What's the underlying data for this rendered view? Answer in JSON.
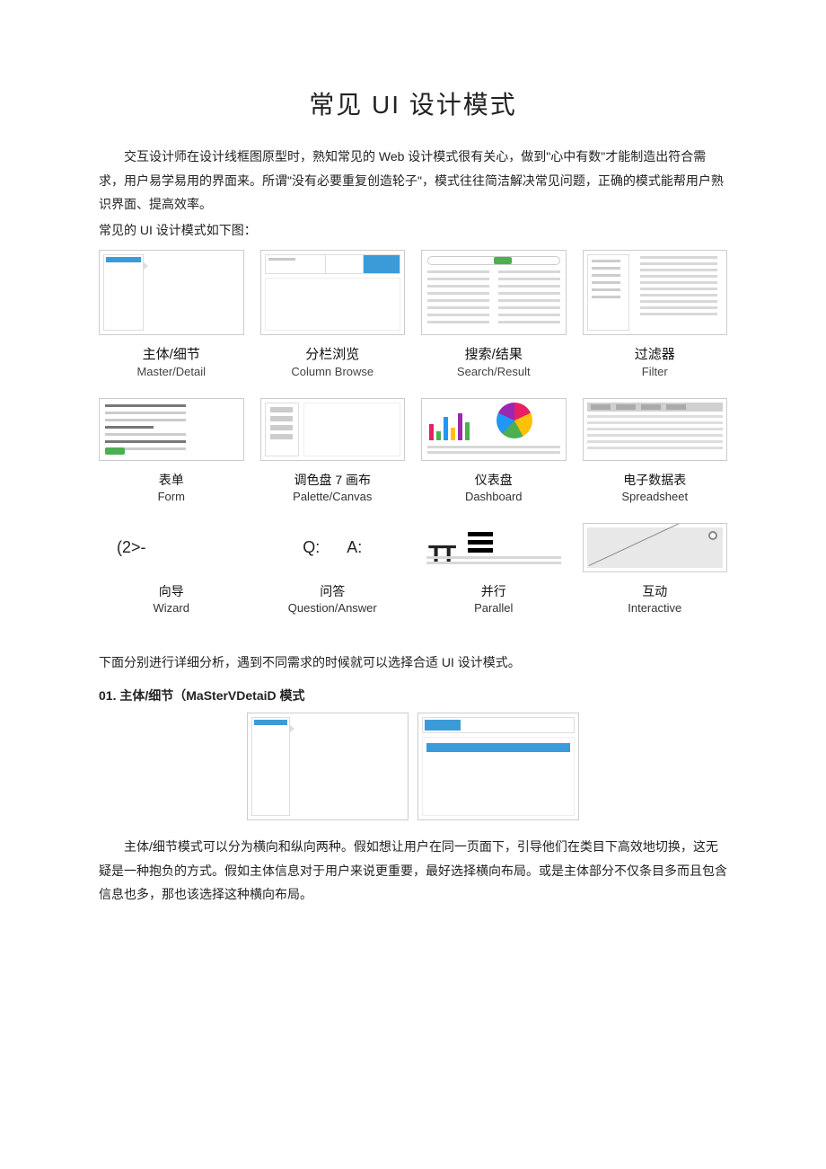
{
  "title": "常见 UI 设计模式",
  "intro": "交互设计师在设计线框图原型时，熟知常见的 Web 设计模式很有关心，做到\"心中有数\"才能制造出符合需求，用户易学易用的界面来。所谓\"没有必要重复创造轮子\"，模式往往简洁解决常见问题，正确的模式能帮用户熟识界面、提高效率。",
  "sub": "常见的 UI 设计模式如下图：",
  "patterns": [
    {
      "cn": "主体/细节",
      "en": "Master/Detail"
    },
    {
      "cn": "分栏浏览",
      "en": "Column Browse"
    },
    {
      "cn": "搜索/结果",
      "en": "Search/Result"
    },
    {
      "cn": "过滤器",
      "en": "Filter"
    },
    {
      "cn": "表单",
      "en": "Form"
    },
    {
      "cn": "调色盘 7 画布",
      "en": "Palette/Canvas"
    },
    {
      "cn": "仪表盘",
      "en": "Dashboard"
    },
    {
      "cn": "电子数据表",
      "en": "Spreadsheet"
    },
    {
      "cn": "向导",
      "en": "Wizard"
    },
    {
      "cn": "问答",
      "en": "Question/Answer"
    },
    {
      "cn": "并行",
      "en": "Parallel"
    },
    {
      "cn": "互动",
      "en": "Interactive"
    }
  ],
  "row3": {
    "wizard_glyph": "(2>-",
    "q": "Q:",
    "a": "A:"
  },
  "analysis_intro": "下面分别进行详细分析，遇到不同需求的时候就可以选择合适 UI 设计模式。",
  "section01_title": "01. 主体/细节（MaSterVDetaiD 模式",
  "section01_body": "主体/细节模式可以分为横向和纵向两种。假如想让用户在同一页面下，引导他们在类目下高效地切换，这无疑是一种抱负的方式。假如主体信息对于用户来说更重要，最好选择横向布局。或是主体部分不仅条目多而且包含信息也多，那也该选择这种横向布局。"
}
